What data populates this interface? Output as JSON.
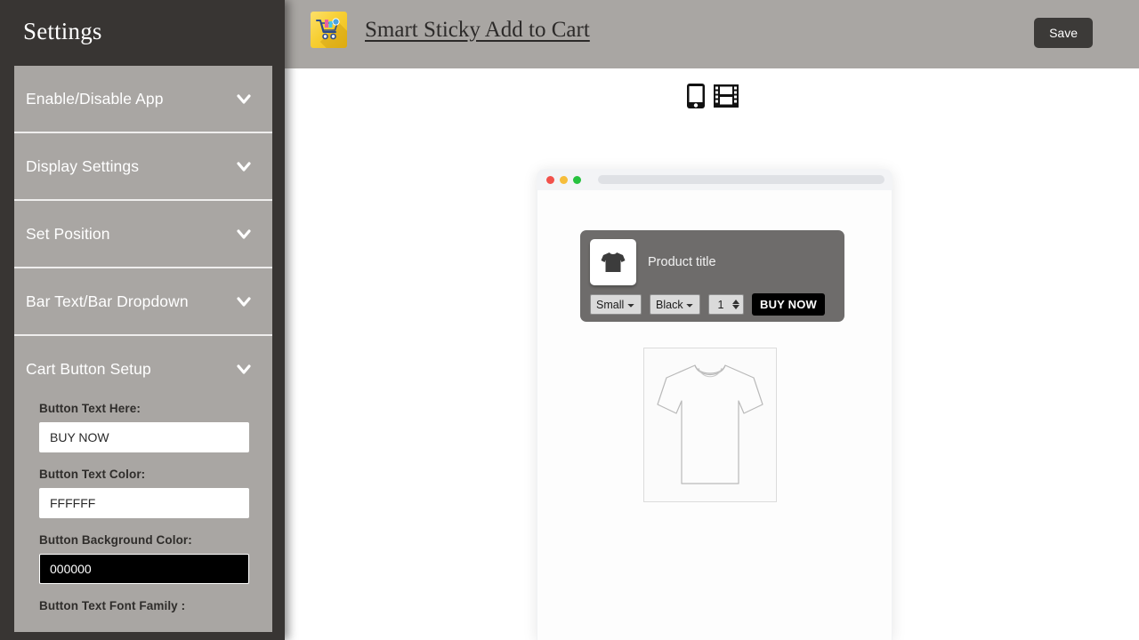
{
  "sidebar": {
    "title": "Settings",
    "sections": [
      {
        "label": "Enable/Disable App",
        "icon": "chevron-down-icon"
      },
      {
        "label": "Display Settings",
        "icon": "chevron-down-icon"
      },
      {
        "label": "Set Position",
        "icon": "chevron-down-icon"
      },
      {
        "label": "Bar Text/Bar Dropdown",
        "icon": "chevron-down-icon"
      },
      {
        "label": "Cart Button Setup",
        "icon": "chevron-down-icon"
      }
    ],
    "cart_button_setup": {
      "fields": [
        {
          "label": "Button Text Here:",
          "value": "BUY NOW",
          "style": "light"
        },
        {
          "label": "Button Text Color:",
          "value": "FFFFFF",
          "style": "light"
        },
        {
          "label": "Button Background Color:",
          "value": "000000",
          "style": "dark"
        }
      ],
      "next_label": "Button Text Font Family :"
    }
  },
  "header": {
    "logo_icon": "shopping-cart-logo-icon",
    "app_title": "Smart Sticky Add to Cart",
    "save_label": "Save"
  },
  "preview": {
    "device_toggle": [
      {
        "name": "mobile-view-icon"
      },
      {
        "name": "desktop-view-icon"
      }
    ],
    "browser": {
      "dots": [
        "red",
        "yellow",
        "green"
      ]
    },
    "sticky_bar": {
      "thumbnail_icon": "tshirt-icon",
      "product_title": "Product title",
      "size_option": "Small",
      "color_option": "Black",
      "quantity": "1",
      "buy_label": "BUY NOW"
    },
    "product_image_icon": "tshirt-outline-image"
  },
  "colors": {
    "sidebar_bg": "#383533",
    "accordion_bg": "#a9a6a3",
    "header_bg": "#a9a6a3",
    "save_bg": "#3c3a38",
    "button_text_color": "#FFFFFF",
    "button_background_color": "#000000",
    "logo_yellow": "#f7cf34"
  }
}
